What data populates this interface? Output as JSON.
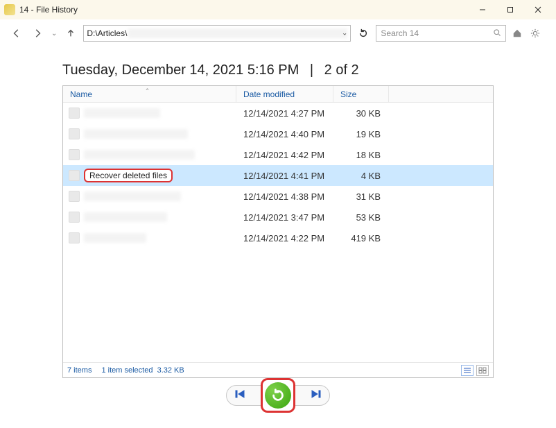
{
  "window": {
    "title": "14 - File History"
  },
  "toolbar": {
    "address": "D:\\Articles\\",
    "search_placeholder": "Search 14"
  },
  "heading": {
    "timestamp": "Tuesday, December 14, 2021 5:16 PM",
    "page_indicator": "2 of 2"
  },
  "columns": {
    "name": "Name",
    "date": "Date modified",
    "size": "Size"
  },
  "rows": [
    {
      "name": "",
      "blurred": true,
      "bw": "w1",
      "date": "12/14/2021 4:27 PM",
      "size": "30 KB",
      "selected": false
    },
    {
      "name": "",
      "blurred": true,
      "bw": "w2",
      "date": "12/14/2021 4:40 PM",
      "size": "19 KB",
      "selected": false
    },
    {
      "name": "",
      "blurred": true,
      "bw": "w3",
      "date": "12/14/2021 4:42 PM",
      "size": "18 KB",
      "selected": false
    },
    {
      "name": "Recover deleted files",
      "blurred": false,
      "bw": "",
      "date": "12/14/2021 4:41 PM",
      "size": "4 KB",
      "selected": true
    },
    {
      "name": "",
      "blurred": true,
      "bw": "w4",
      "date": "12/14/2021 4:38 PM",
      "size": "31 KB",
      "selected": false
    },
    {
      "name": "",
      "blurred": true,
      "bw": "w5",
      "date": "12/14/2021 3:47 PM",
      "size": "53 KB",
      "selected": false
    },
    {
      "name": "",
      "blurred": true,
      "bw": "w6",
      "date": "12/14/2021 4:22 PM",
      "size": "419 KB",
      "selected": false
    }
  ],
  "status": {
    "count": "7 items",
    "selection": "1 item selected",
    "sel_size": "3.32 KB"
  }
}
